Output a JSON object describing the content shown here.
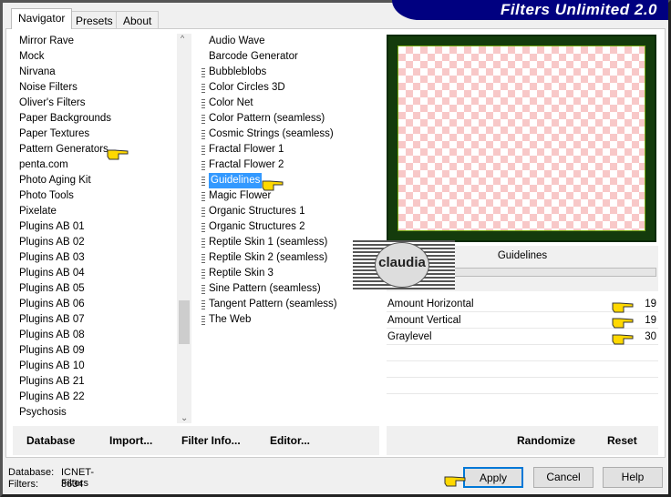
{
  "banner": "Filters Unlimited 2.0",
  "tabs": [
    "Navigator",
    "Presets",
    "About"
  ],
  "categories": [
    "Mirror Rave",
    "Mock",
    "Nirvana",
    "Noise Filters",
    "Oliver's Filters",
    "Paper Backgrounds",
    "Paper Textures",
    "Pattern Generators",
    "penta.com",
    "Photo Aging Kit",
    "Photo Tools",
    "Pixelate",
    "Plugins AB 01",
    "Plugins AB 02",
    "Plugins AB 03",
    "Plugins AB 04",
    "Plugins AB 05",
    "Plugins AB 06",
    "Plugins AB 07",
    "Plugins AB 08",
    "Plugins AB 09",
    "Plugins AB 10",
    "Plugins AB 21",
    "Plugins AB 22",
    "Psychosis"
  ],
  "filters": [
    "Audio Wave",
    "Barcode Generator",
    "Bubbleblobs",
    "Color Circles 3D",
    "Color Net",
    "Color Pattern (seamless)",
    "Cosmic Strings (seamless)",
    "Fractal Flower 1",
    "Fractal Flower 2",
    "Guidelines",
    "Magic Flower",
    "Organic Structures 1",
    "Organic Structures 2",
    "Reptile Skin 1 (seamless)",
    "Reptile Skin 2 (seamless)",
    "Reptile Skin 3",
    "Sine Pattern (seamless)",
    "Tangent Pattern (seamless)",
    "The Web"
  ],
  "selected_category": "Pattern Generators",
  "selected_filter": "Guidelines",
  "filter_title": "Guidelines",
  "params": [
    {
      "label": "Amount Horizontal",
      "value": "19"
    },
    {
      "label": "Amount Vertical",
      "value": "19"
    },
    {
      "label": "Graylevel",
      "value": "30"
    }
  ],
  "buttons": {
    "database": "Database",
    "import": "Import...",
    "filter_info": "Filter Info...",
    "editor": "Editor...",
    "randomize": "Randomize",
    "reset": "Reset",
    "apply": "Apply",
    "cancel": "Cancel",
    "help": "Help"
  },
  "status": {
    "database_label": "Database:",
    "database_value": "ICNET-Filters",
    "filters_label": "Filters:",
    "filters_value": "3634"
  },
  "watermark": "claudia",
  "colors": {
    "selection": "#3399ff",
    "banner": "#000080",
    "preview_border": "#143b0c",
    "checker": "#f8c8c8"
  }
}
